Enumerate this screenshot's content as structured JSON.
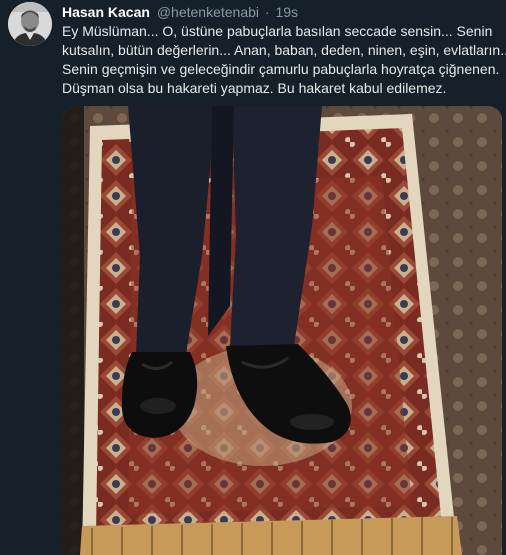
{
  "tweet": {
    "author_name": "Hasan Kacan",
    "author_handle": "@hetenketenabi",
    "separator": "·",
    "timestamp": "19s",
    "text_lines": [
      "Ey Müslüman... O, üstüne pabuçlarla basılan seccade sensin... Senin",
      "kutsalın, bütün değerlerin... Anan, baban, deden, ninen, eşin, evlatların...",
      "Senin geçmişin ve geleceğindir çamurlu pabuçlarla hoyratça çiğnenen.",
      "Düşman olsa bu hakareti yapmaz. Bu hakaret kabul edilemez."
    ],
    "avatar_icon": "author-avatar-portrait",
    "media_icon": "photo-shoes-on-prayer-rug"
  }
}
